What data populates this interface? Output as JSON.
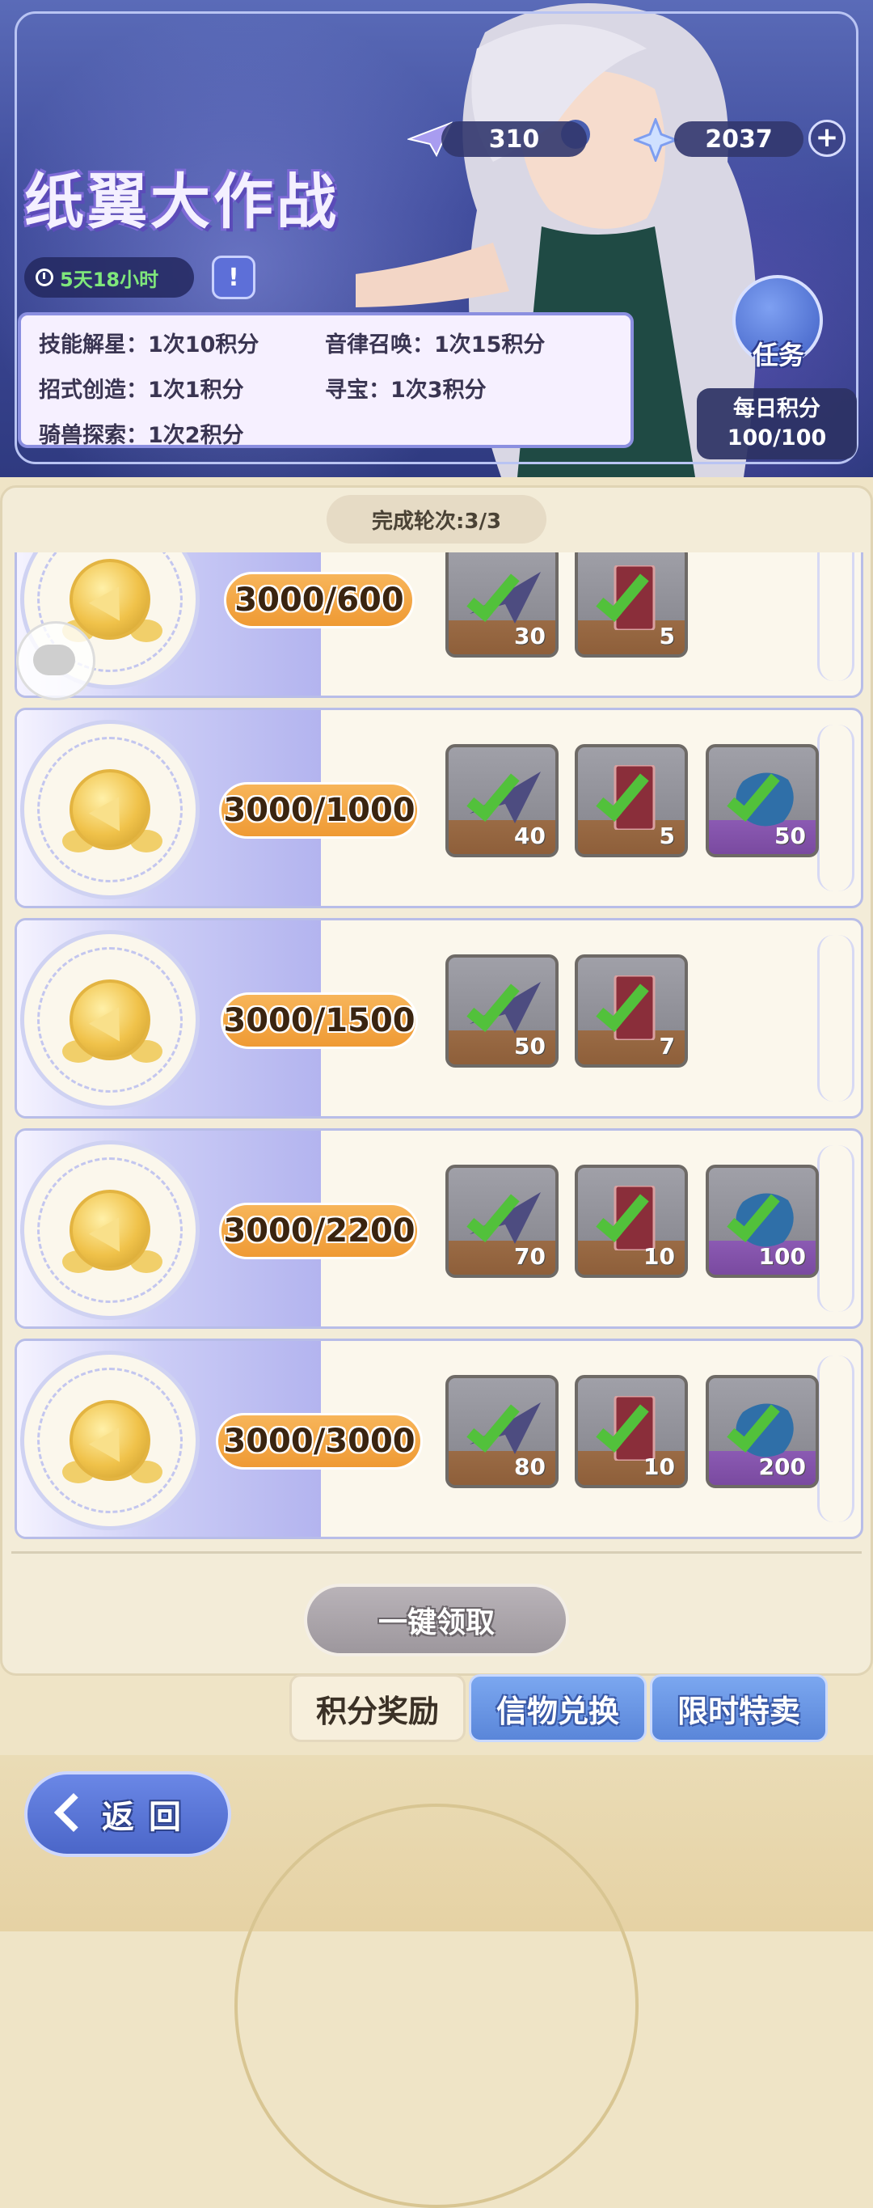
{
  "header": {
    "title": "纸翼大作战",
    "timer": "5天18小时",
    "info_icon": "!",
    "currency_plane": "310",
    "currency_star": "2037",
    "task_label": "任务",
    "daily_label": "每日积分",
    "daily_value": "100/100",
    "rules": [
      "技能解星：1次10积分",
      "音律召唤：1次15积分",
      "招式创造：1次1积分",
      "寻宝：1次3积分",
      "骑兽探索：1次2积分"
    ]
  },
  "panel": {
    "rounds": "完成轮次:3/3",
    "rows": [
      {
        "progress": "3000/600",
        "rewards": [
          {
            "kind": "plane",
            "qty": "30"
          },
          {
            "kind": "card",
            "qty": "5"
          }
        ]
      },
      {
        "progress": "3000/1000",
        "rewards": [
          {
            "kind": "plane",
            "qty": "40"
          },
          {
            "kind": "card",
            "qty": "5"
          },
          {
            "kind": "crystal",
            "qty": "50"
          }
        ]
      },
      {
        "progress": "3000/1500",
        "rewards": [
          {
            "kind": "plane",
            "qty": "50"
          },
          {
            "kind": "card",
            "qty": "7"
          }
        ]
      },
      {
        "progress": "3000/2200",
        "rewards": [
          {
            "kind": "plane",
            "qty": "70"
          },
          {
            "kind": "card",
            "qty": "10"
          },
          {
            "kind": "crystal",
            "qty": "100"
          }
        ]
      },
      {
        "progress": "3000/3000",
        "rewards": [
          {
            "kind": "plane",
            "qty": "80"
          },
          {
            "kind": "card",
            "qty": "10"
          },
          {
            "kind": "crystal",
            "qty": "200"
          }
        ]
      }
    ],
    "claim_all": "一键领取"
  },
  "tabs": [
    "积分奖励",
    "信物兑换",
    "限时特卖"
  ],
  "back_label": "返回",
  "colors": {
    "accent": "#ef9a34",
    "check": "#52c13b",
    "tab_blue": "#5a86d9"
  }
}
